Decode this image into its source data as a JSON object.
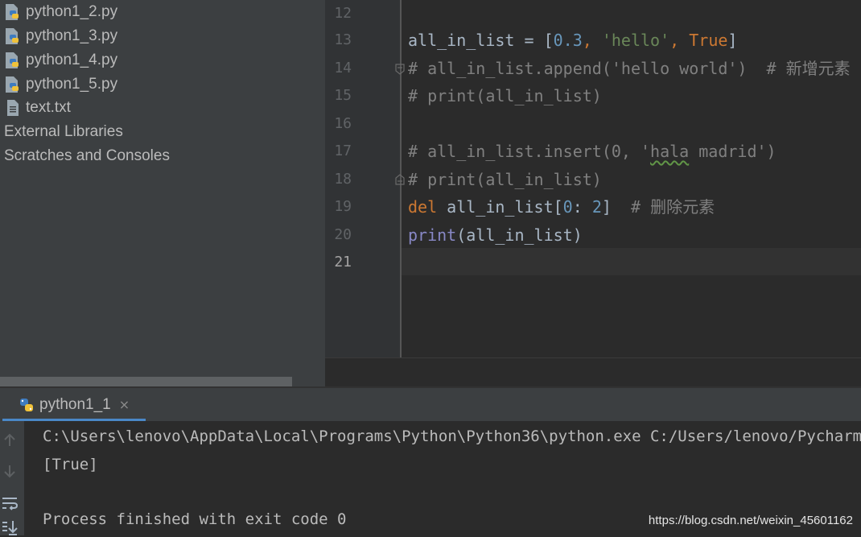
{
  "project_tree": {
    "files": [
      {
        "name": "python1_2.py",
        "icon": "python-file-icon"
      },
      {
        "name": "python1_3.py",
        "icon": "python-file-icon"
      },
      {
        "name": "python1_4.py",
        "icon": "python-file-icon"
      },
      {
        "name": "python1_5.py",
        "icon": "python-file-icon"
      },
      {
        "name": "text.txt",
        "icon": "text-file-icon"
      }
    ],
    "external_libraries": "External Libraries",
    "scratches": "Scratches and Consoles"
  },
  "editor": {
    "line_numbers": [
      "12",
      "13",
      "14",
      "15",
      "16",
      "17",
      "18",
      "19",
      "20",
      "21"
    ],
    "current_line": "21",
    "lines": {
      "l13": {
        "var": "all_in_list",
        "eq": " = [",
        "num": "0.3",
        "c1": ", ",
        "str": "'hello'",
        "c2": ", ",
        "kw": "True",
        "close": "]"
      },
      "l14": "# all_in_list.append('hello world')  # 新增元素",
      "l15": "# print(all_in_list)",
      "l17": {
        "pre": "# all_in_list.insert(0, '",
        "typo": "hala",
        "post": " madrid')"
      },
      "l18": "# print(all_in_list)",
      "l19": {
        "kw": "del",
        "var": " all_in_list[",
        "n1": "0",
        "colon": ": ",
        "n2": "2",
        "close": "]",
        "cmt": "  # 删除元素"
      },
      "l20": {
        "fn": "print",
        "rest": "(all_in_list)"
      }
    }
  },
  "run_panel": {
    "tab_label": "python1_1",
    "close_glyph": "×",
    "console_lines": [
      "C:\\Users\\lenovo\\AppData\\Local\\Programs\\Python\\Python36\\python.exe C:/Users/lenovo/PycharmProjects",
      "[True]",
      "",
      "Process finished with exit code 0"
    ]
  },
  "watermark": "https://blog.csdn.net/weixin_45601162",
  "colors": {
    "keyword": "#cc7832",
    "string": "#6a8759",
    "number": "#6897bb",
    "comment": "#808080",
    "builtin": "#8888c6",
    "text": "#a9b7c6",
    "accent": "#4a88c7"
  }
}
